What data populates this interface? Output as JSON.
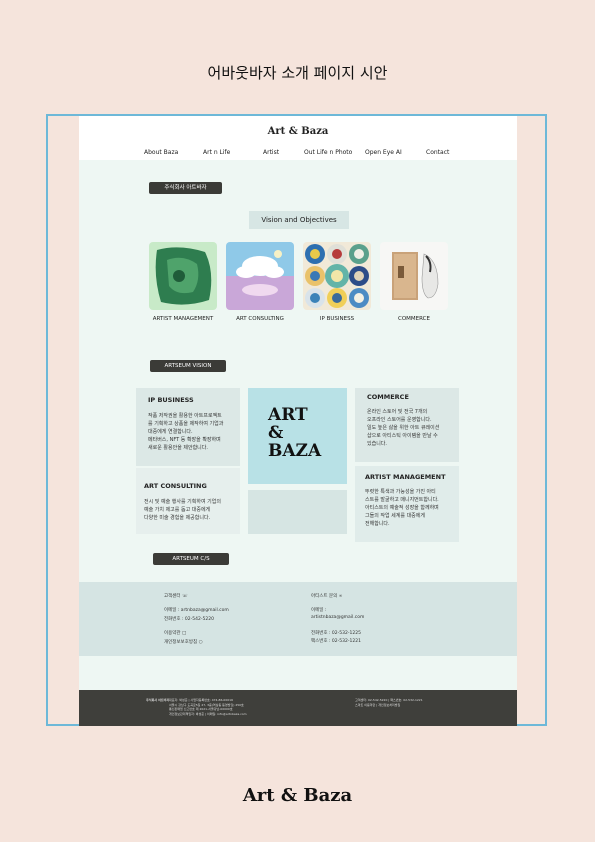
{
  "heading": "어바웃바자 소개 페이지 시안",
  "site": {
    "logo": "Art & Baza",
    "nav": [
      "About Baza",
      "Art n Life",
      "Artist",
      "Out Life n Photo",
      "Open Eye AI",
      "Contact"
    ],
    "company_pill": "주식회사 아트바자",
    "vision_objectives": "Vision and Objectives",
    "thumbs": [
      {
        "label": "ARTIST MANAGEMENT",
        "icon": "green-painting-icon"
      },
      {
        "label": "ART CONSULTING",
        "icon": "cloud-sky-art-icon"
      },
      {
        "label": "IP BUSINESS",
        "icon": "decorative-plates-icon"
      },
      {
        "label": "COMMERCE",
        "icon": "product-box-icon"
      }
    ],
    "vision_pill": "ARTSEUM VISION",
    "cards": {
      "ip": {
        "title": "IP BUSINESS",
        "body": "작품 저작권을 활용한 아트프로젝트\n를 기획하고 상품을 제작하여 기업과\n대중에게 연결합니다.\n메타버스, NFT 등 확장을 확장하며\n새로운 활용안을 제안합니다."
      },
      "consulting": {
        "title": "ART CONSULTING",
        "body": "전시 및 예술 행사를 기획하여 기업의\n예술 가치 제고를 돕고 대중에게\n다양한 미술 경험을 제공합니다."
      },
      "center": {
        "line1": "ART",
        "line2": "&",
        "line3": "BAZA"
      },
      "commerce": {
        "title": "COMMERCE",
        "body": "온라인 스토어 및 전국 7개의\n오프라인 스토어를 운영합니다.\n일도 높은 삶을 위한 아트 큐레이션\n샵으로 아티스틱 아이템을 만날 수\n있습니다."
      },
      "artist": {
        "title": "ARTIST MANAGEMENT",
        "body": "뚜렷한 특색과 가능성을 가진 아티\n스트를 발굴하고 매니지먼트합니다.\n아티스트의 예술적 성장을 함께하며\n그들의 작업 세계를 대중에게\n전해합니다."
      }
    },
    "cs_pill": "ARTSEUM C/S",
    "footer_left": {
      "title": "고객센터",
      "email": "이메일 : artnbaza@gmail.com",
      "phone": "전화번호 : 02-542-5220",
      "terms1": "이용약관",
      "terms2": "개인정보보호방침"
    },
    "footer_right": {
      "title": "아티스트 문의",
      "email_label": "이메일 :",
      "email": "artistnbaza@gmail.com",
      "phone": "전화번호 : 02-532-1225",
      "fax": "팩스번호 : 02-532-1221"
    },
    "bottom_left_label": "주식회사 아트바자",
    "bottom_left_lines": [
      "대표자: 박성준 | 사업자등록번호: 474-86-00016",
      "서울시 강남구 도곡로5길 27, 3층(역삼동 동영빌딩) 250호",
      "통신판매업 신고번호 제 2021-서울강남-00000호",
      "개인정보관리책임자: 박성준 | 이메일: info@artnbaza.com"
    ],
    "bottom_right_lines": [
      "고객센터: 02-542-5220 | 팩스번호: 02-532-1221",
      "스마트 이용약관 | 개인정보처리방침"
    ]
  },
  "bottom_logo": "Art & Baza"
}
